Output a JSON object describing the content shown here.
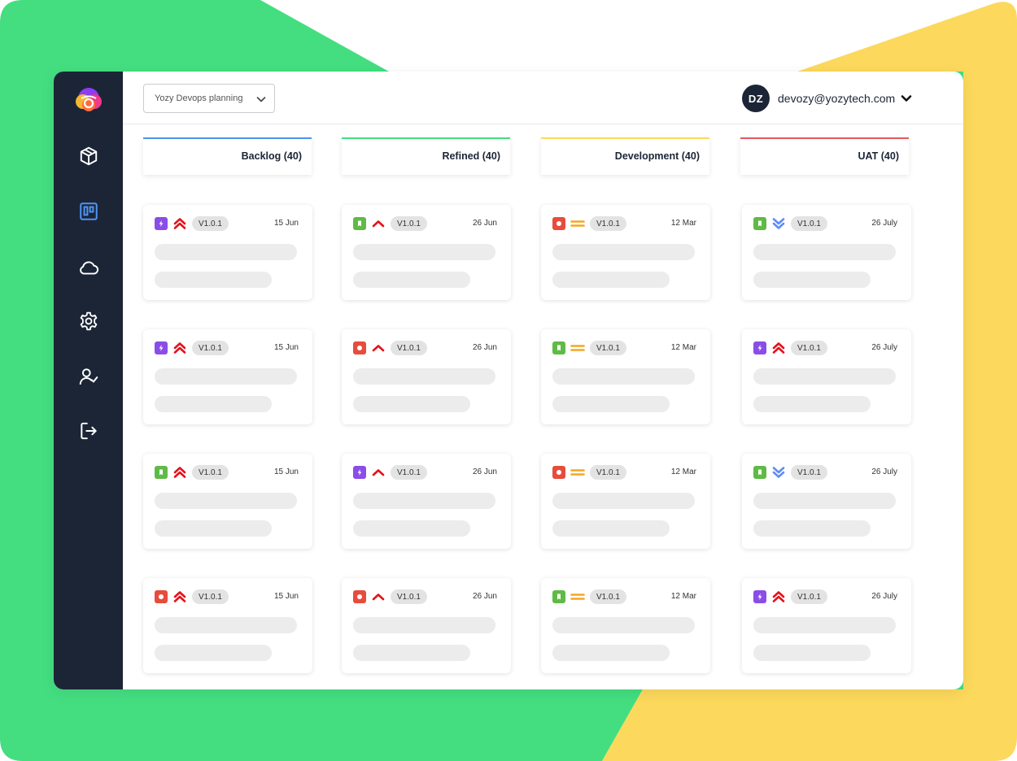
{
  "colors": {
    "green_bg": "#44de80",
    "yellow_bg": "#fcd95c",
    "sidebar": "#1c2536",
    "active_nav": "#4e93f2",
    "story": "#5fba46",
    "task": "#8b4de8",
    "bug": "#e74c3c",
    "high": "#e5121b",
    "medium": "#f5a623",
    "low": "#5d8df5"
  },
  "sidebar": {
    "items": [
      {
        "name": "box-icon",
        "active": false
      },
      {
        "name": "board-icon",
        "active": true
      },
      {
        "name": "cloud-icon",
        "active": false
      },
      {
        "name": "gear-icon",
        "active": false
      },
      {
        "name": "user-check-icon",
        "active": false
      },
      {
        "name": "logout-icon",
        "active": false
      }
    ]
  },
  "header": {
    "project": "Yozy Devops planning",
    "avatar_initials": "DZ",
    "email": "devozy@yozytech.com"
  },
  "columns": [
    {
      "label": "Backlog (40)",
      "accent": "#4e93f2",
      "date": "15 Jun",
      "cards": [
        {
          "type": "task",
          "priority": "highest",
          "version": "V1.0.1",
          "date": "15 Jun"
        },
        {
          "type": "task",
          "priority": "highest",
          "version": "V1.0.1",
          "date": "15 Jun"
        },
        {
          "type": "story",
          "priority": "highest",
          "version": "V1.0.1",
          "date": "15 Jun"
        },
        {
          "type": "bug",
          "priority": "highest",
          "version": "V1.0.1",
          "date": "15 Jun"
        }
      ]
    },
    {
      "label": "Refined (40)",
      "accent": "#44de80",
      "cards": [
        {
          "type": "story",
          "priority": "high",
          "version": "V1.0.1",
          "date": "26 Jun"
        },
        {
          "type": "bug",
          "priority": "high",
          "version": "V1.0.1",
          "date": "26 Jun"
        },
        {
          "type": "task",
          "priority": "high",
          "version": "V1.0.1",
          "date": "26 Jun"
        },
        {
          "type": "bug",
          "priority": "high",
          "version": "V1.0.1",
          "date": "26 Jun"
        }
      ]
    },
    {
      "label": "Development (40)",
      "accent": "#fcd95c",
      "cards": [
        {
          "type": "bug",
          "priority": "medium",
          "version": "V1.0.1",
          "date": "12 Mar"
        },
        {
          "type": "story",
          "priority": "medium",
          "version": "V1.0.1",
          "date": "12 Mar"
        },
        {
          "type": "bug",
          "priority": "medium",
          "version": "V1.0.1",
          "date": "12 Mar"
        },
        {
          "type": "story",
          "priority": "medium",
          "version": "V1.0.1",
          "date": "12 Mar"
        }
      ]
    },
    {
      "label": "UAT (40)",
      "accent": "#e5575f",
      "cards": [
        {
          "type": "story",
          "priority": "lowest",
          "version": "V1.0.1",
          "date": "26 July"
        },
        {
          "type": "task",
          "priority": "highest",
          "version": "V1.0.1",
          "date": "26 July"
        },
        {
          "type": "story",
          "priority": "lowest",
          "version": "V1.0.1",
          "date": "26 July"
        },
        {
          "type": "task",
          "priority": "highest",
          "version": "V1.0.1",
          "date": "26 July"
        }
      ]
    }
  ]
}
